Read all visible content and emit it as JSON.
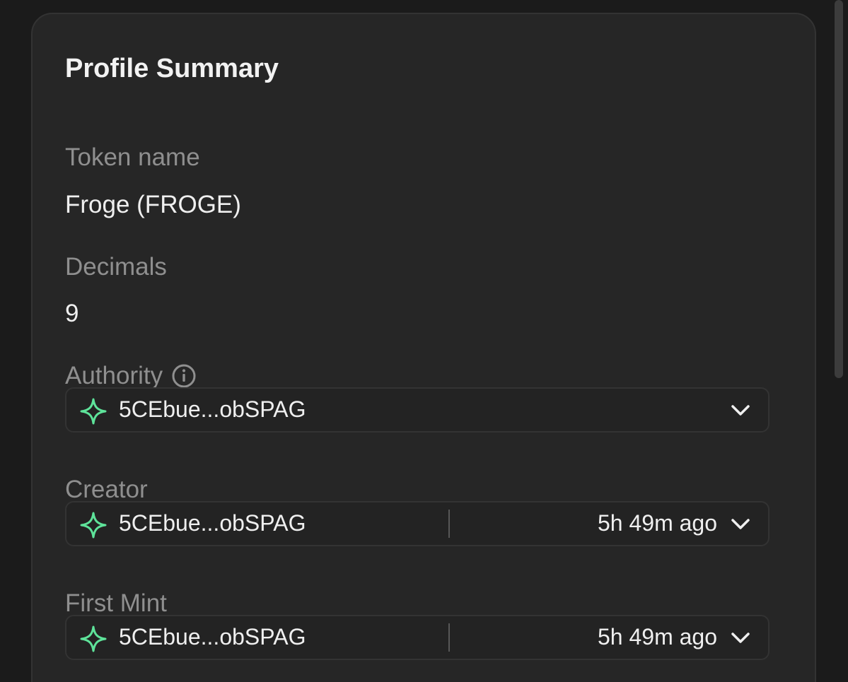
{
  "card": {
    "title": "Profile Summary"
  },
  "token_name": {
    "label": "Token name",
    "value": "Froge (FROGE)"
  },
  "decimals": {
    "label": "Decimals",
    "value": "9"
  },
  "authority": {
    "label": "Authority",
    "icon": "info-icon",
    "address": "5CEbue...obSPAG",
    "address_icon": "sparkle-icon"
  },
  "creator": {
    "label": "Creator",
    "address": "5CEbue...obSPAG",
    "address_icon": "sparkle-icon",
    "time": "5h 49m ago"
  },
  "first_mint": {
    "label": "First Mint",
    "address": "5CEbue...obSPAG",
    "address_icon": "sparkle-icon",
    "time": "5h 49m ago"
  },
  "colors": {
    "accent": "#5ee39a",
    "background": "#1b1b1b",
    "card": "#262626",
    "label": "#8f8f8f"
  }
}
